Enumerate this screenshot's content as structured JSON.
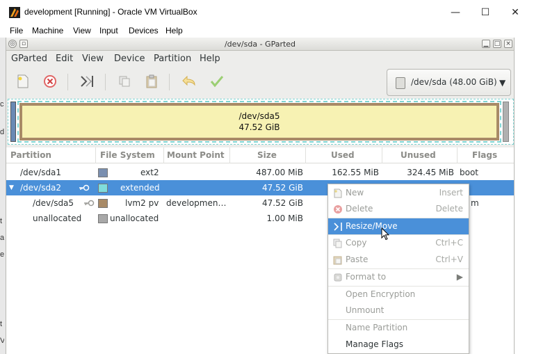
{
  "host": {
    "title": "development [Running] - Oracle VM VirtualBox",
    "window_controls": {
      "minimize": "—",
      "maximize": "☐",
      "close": "✕"
    },
    "menu": [
      "File",
      "Machine",
      "View",
      "Input",
      "Devices",
      "Help"
    ],
    "left_peek": [
      "c",
      "d",
      "t",
      "ap",
      "e",
      "t",
      "V/"
    ]
  },
  "gparted": {
    "title": "/dev/sda - GParted",
    "menu": [
      "GParted",
      "Edit",
      "View",
      "Device",
      "Partition",
      "Help"
    ],
    "device": "/dev/sda (48.00 GiB)",
    "graphic": {
      "name": "/dev/sda5",
      "size": "47.52 GiB"
    },
    "columns": [
      "Partition",
      "File System",
      "Mount Point",
      "Size",
      "Used",
      "Unused",
      "Flags"
    ],
    "rows": [
      {
        "partition": "/dev/sda1",
        "fs": "ext2",
        "mount": "",
        "size": "487.00 MiB",
        "used": "162.55 MiB",
        "unused": "324.45 MiB",
        "flags": "boot",
        "color": "#7a8fb0"
      },
      {
        "partition": "/dev/sda2",
        "fs": "extended",
        "mount": "",
        "size": "47.52 GiB",
        "used": "",
        "unused": "",
        "flags": "",
        "color": "#7fdcdc"
      },
      {
        "partition": "/dev/sda5",
        "fs": "lvm2 pv",
        "mount": "developmen…",
        "size": "47.52 GiB",
        "used": "",
        "unused": "",
        "flags": "m",
        "color": "#a88a67"
      },
      {
        "partition": "unallocated",
        "fs": "unallocated",
        "mount": "",
        "size": "1.00 MiB",
        "used": "",
        "unused": "",
        "flags": "",
        "color": "#a8a8a8"
      }
    ]
  },
  "context_menu": {
    "items": [
      {
        "label": "New",
        "accel": "Insert"
      },
      {
        "label": "Delete",
        "accel": "Delete"
      },
      {
        "label": "Resize/Move",
        "accel": ""
      },
      {
        "label": "Copy",
        "accel": "Ctrl+C"
      },
      {
        "label": "Paste",
        "accel": "Ctrl+V"
      },
      {
        "label": "Format to",
        "accel": ""
      },
      {
        "label": "Open Encryption",
        "accel": ""
      },
      {
        "label": "Unmount",
        "accel": ""
      },
      {
        "label": "Name Partition",
        "accel": ""
      },
      {
        "label": "Manage Flags",
        "accel": ""
      }
    ]
  }
}
